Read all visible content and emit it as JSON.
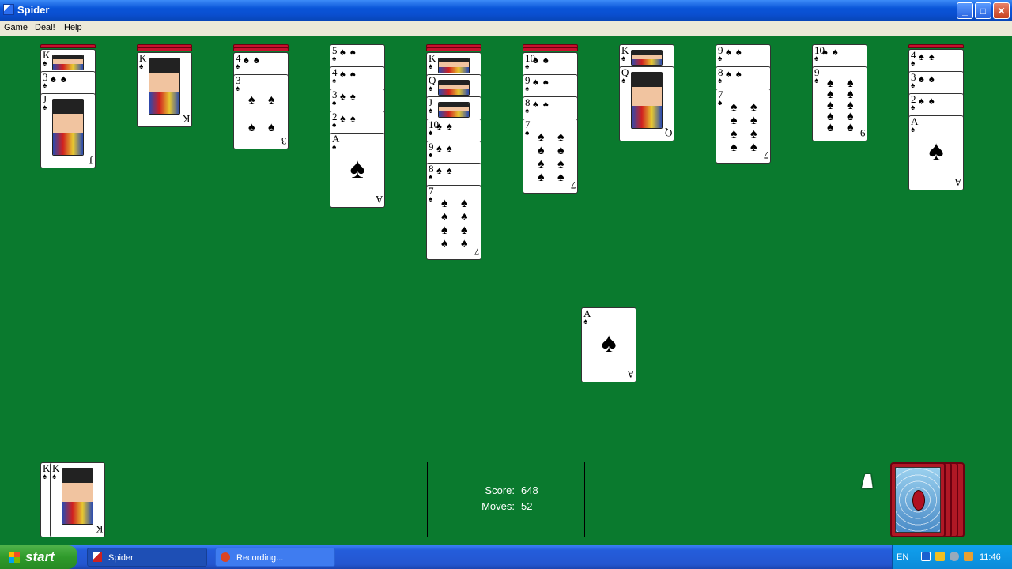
{
  "window": {
    "title": "Spider",
    "min": "_",
    "max": "□",
    "close": "✕"
  },
  "menu": [
    "Game",
    "Deal!",
    "Help"
  ],
  "colors": {
    "felt": "#0a7a2e",
    "card_back": "#c8102e",
    "taskbar": "#245ddb"
  },
  "score": {
    "score_label": "Score:",
    "score_value": "648",
    "moves_label": "Moves:",
    "moves_value": "52"
  },
  "tableau": [
    {
      "hidden": 1,
      "visible": [
        "K",
        "3",
        "J"
      ]
    },
    {
      "hidden": 2,
      "visible": [
        "K"
      ]
    },
    {
      "hidden": 2,
      "visible": [
        "4",
        "3"
      ]
    },
    {
      "hidden": 0,
      "visible": [
        "5",
        "4",
        "3",
        "2",
        "A"
      ]
    },
    {
      "hidden": 2,
      "visible": [
        "K",
        "Q",
        "J",
        "10",
        "9",
        "8",
        "7"
      ]
    },
    {
      "hidden": 2,
      "visible": [
        "10",
        "9",
        "8",
        "7"
      ]
    },
    {
      "hidden": 0,
      "visible": [
        "K",
        "Q"
      ]
    },
    {
      "hidden": 0,
      "visible": [
        "9",
        "8",
        "7"
      ]
    },
    {
      "hidden": 0,
      "visible": [
        "10",
        "9"
      ]
    },
    {
      "hidden": 1,
      "visible": [
        "4",
        "3",
        "2",
        "A"
      ]
    }
  ],
  "drag_card": "A",
  "completed": [
    "K",
    "K"
  ],
  "stock_piles": 4,
  "suit_symbol": "♠",
  "taskbar": {
    "start_label": "start",
    "tasks": [
      "Spider",
      "Recording..."
    ],
    "lang": "EN",
    "clock": "11:46"
  }
}
